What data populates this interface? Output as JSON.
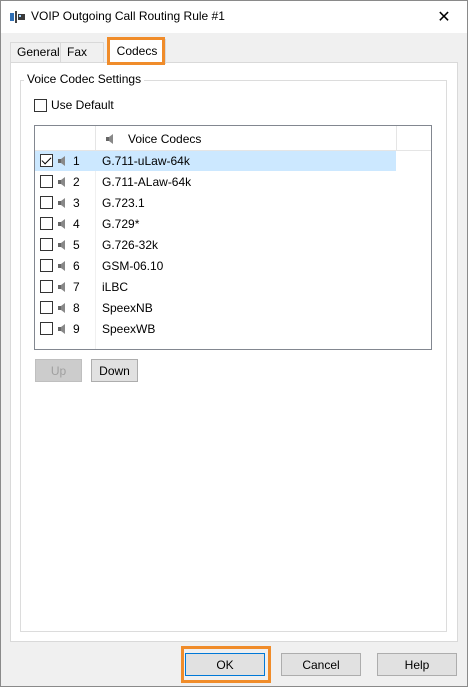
{
  "window": {
    "title": "VOIP Outgoing Call Routing Rule #1",
    "close_glyph": "✕",
    "app_icon": "phone-network-icon"
  },
  "tabs": [
    {
      "label": "General",
      "active": false
    },
    {
      "label": "Fax",
      "active": false
    },
    {
      "label": "Codecs",
      "active": true
    }
  ],
  "group": {
    "label": "Voice Codec Settings",
    "use_default_label": "Use Default",
    "use_default_checked": false
  },
  "codec_list": {
    "header_label": "Voice Codecs",
    "header_icon": "speaker-icon",
    "rows": [
      {
        "index": "1",
        "name": "G.711-uLaw-64k",
        "checked": true,
        "selected": true
      },
      {
        "index": "2",
        "name": "G.711-ALaw-64k",
        "checked": false,
        "selected": false
      },
      {
        "index": "3",
        "name": "G.723.1",
        "checked": false,
        "selected": false
      },
      {
        "index": "4",
        "name": "G.729*",
        "checked": false,
        "selected": false
      },
      {
        "index": "5",
        "name": "G.726-32k",
        "checked": false,
        "selected": false
      },
      {
        "index": "6",
        "name": "GSM-06.10",
        "checked": false,
        "selected": false
      },
      {
        "index": "7",
        "name": "iLBC",
        "checked": false,
        "selected": false
      },
      {
        "index": "8",
        "name": "SpeexNB",
        "checked": false,
        "selected": false
      },
      {
        "index": "9",
        "name": "SpeexWB",
        "checked": false,
        "selected": false
      }
    ]
  },
  "buttons": {
    "up": "Up",
    "down": "Down",
    "ok": "OK",
    "cancel": "Cancel",
    "help": "Help"
  },
  "colors": {
    "highlight": "#f08c2a",
    "selection": "#cce8ff",
    "default_button_border": "#0078d7"
  }
}
